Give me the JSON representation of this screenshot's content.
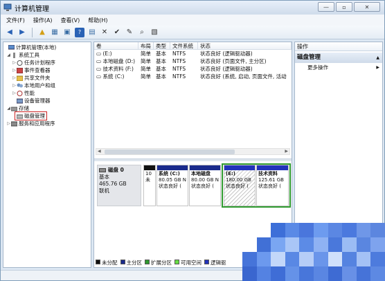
{
  "window": {
    "title": "计算机管理"
  },
  "window_buttons": {
    "minimize": "—",
    "restore": "▫",
    "close": "✕"
  },
  "menu": [
    "文件(F)",
    "操作(A)",
    "查看(V)",
    "帮助(H)"
  ],
  "toolbar": {
    "back": "◀",
    "forward": "▶",
    "up": "▲",
    "show_hide": "▦",
    "help": "?",
    "properties": "▣",
    "export": "▤",
    "delete": "✕",
    "check": "✔",
    "open": "✎",
    "search": "⌕",
    "properties2": "▧"
  },
  "tree": {
    "root": "计算机管理(本地)",
    "system_tools": "系统工具",
    "task_scheduler": "任务计划程序",
    "event_viewer": "事件查看器",
    "shared_folders": "共享文件夹",
    "local_users": "本地用户和组",
    "performance": "性能",
    "device_manager": "设备管理器",
    "storage": "存储",
    "disk_management": "磁盘管理",
    "services": "服务和应用程序"
  },
  "volume_table": {
    "headers": [
      "卷",
      "布局",
      "类型",
      "文件系统",
      "状态"
    ],
    "rows": [
      [
        "(E:)",
        "简单",
        "基本",
        "NTFS",
        "状态良好 (逻辑驱动器)"
      ],
      [
        "本地磁盘 (D:)",
        "简单",
        "基本",
        "NTFS",
        "状态良好 (页面文件, 主分区)"
      ],
      [
        "技术资料 (F:)",
        "简单",
        "基本",
        "NTFS",
        "状态良好 (逻辑驱动器)"
      ],
      [
        "系统 (C:)",
        "简单",
        "基本",
        "NTFS",
        "状态良好 (系统, 启动, 页面文件, 活动"
      ]
    ]
  },
  "scroll_arrows": {
    "left": "◀",
    "right": "▶"
  },
  "disk": {
    "name": "磁盘 0",
    "type": "基本",
    "size": "465.76 GB",
    "status": "联机",
    "partitions": [
      {
        "line1": "10",
        "line2": "未",
        "line3": ""
      },
      {
        "name": "系统 (C:)",
        "size": "80.05 GB N",
        "status": "状态良好 ("
      },
      {
        "name": "本地磁盘",
        "size": "80.00 GB N",
        "status": "状态良好 ("
      },
      {
        "name": "(E:)",
        "size": "180.00 GB",
        "status": "状态良好 ("
      },
      {
        "name": "技术资料",
        "size": "125.61 GB",
        "status": "状态良好 ("
      }
    ]
  },
  "legend": [
    {
      "label": "未分配",
      "color": "#111111"
    },
    {
      "label": "主分区",
      "color": "#1a2b8c"
    },
    {
      "label": "扩展分区",
      "color": "#2f9a2f"
    },
    {
      "label": "可用空间",
      "color": "#66dd44"
    },
    {
      "label": "逻辑驱",
      "color": "#2233bb"
    }
  ],
  "actions": {
    "header": "操作",
    "section_title": "磁盘管理",
    "section_arrow": "▲",
    "more": "更多操作",
    "more_arrow": "▶"
  },
  "colors": {
    "primary_partition_bar": "#1a2b8c",
    "logical_bar": "#2233bb",
    "unallocated_bar": "#111111",
    "extended_border": "#2f9a2f",
    "selection_box": "#cc2222"
  }
}
